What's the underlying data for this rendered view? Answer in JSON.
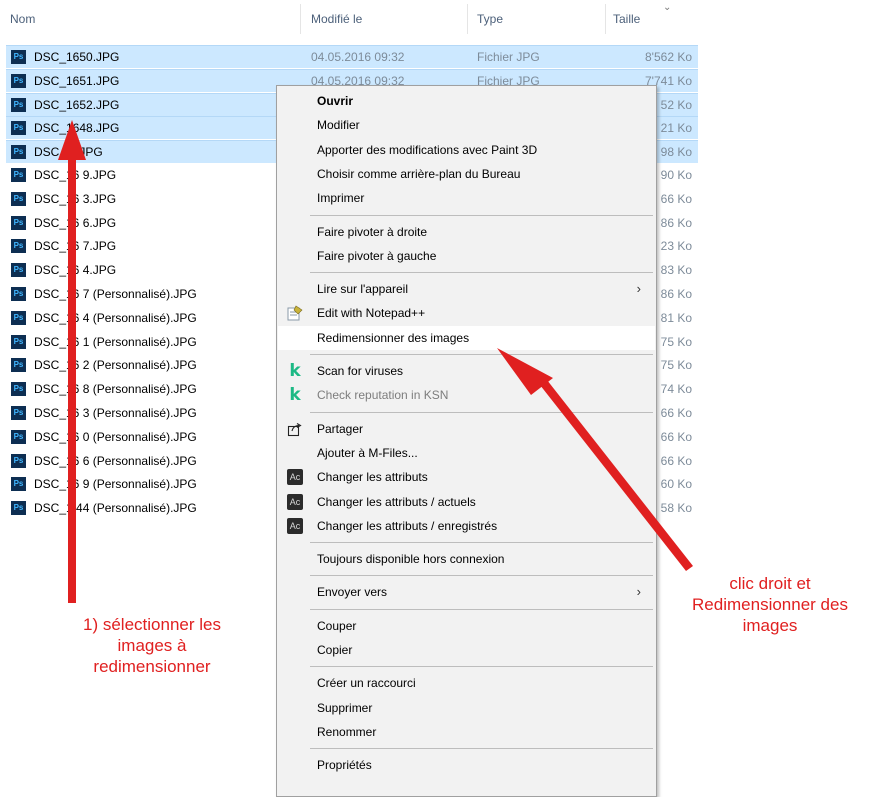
{
  "header": {
    "name": "Nom",
    "modified": "Modifié le",
    "type": "Type",
    "size": "Taille"
  },
  "files": [
    {
      "name": "DSC_1650.JPG",
      "date": "04.05.2016 09:32",
      "type": "Fichier JPG",
      "size": "8'562 Ko",
      "selected": true
    },
    {
      "name": "DSC_1651.JPG",
      "date": "04.05.2016 09:32",
      "type": "Fichier JPG",
      "size": "7'741 Ko",
      "selected": true
    },
    {
      "name": "DSC_1652.JPG",
      "date": "",
      "type": "",
      "size": "52 Ko",
      "selected": true
    },
    {
      "name": "DSC_1648.JPG",
      "date": "",
      "type": "",
      "size": "21 Ko",
      "selected": true
    },
    {
      "name": "DSC_1 .JPG",
      "date": "",
      "type": "",
      "size": "98 Ko",
      "selected": true
    },
    {
      "name": "DSC_16 9.JPG",
      "date": "",
      "type": "",
      "size": "90 Ko",
      "selected": false
    },
    {
      "name": "DSC_16 3.JPG",
      "date": "",
      "type": "",
      "size": "66 Ko",
      "selected": false
    },
    {
      "name": "DSC_16 6.JPG",
      "date": "",
      "type": "",
      "size": "86 Ko",
      "selected": false
    },
    {
      "name": "DSC_16 7.JPG",
      "date": "",
      "type": "",
      "size": "23 Ko",
      "selected": false
    },
    {
      "name": "DSC_16 4.JPG",
      "date": "",
      "type": "",
      "size": "83 Ko",
      "selected": false
    },
    {
      "name": "DSC_16 7 (Personnalisé).JPG",
      "date": "",
      "type": "",
      "size": "86 Ko",
      "selected": false
    },
    {
      "name": "DSC_16 4 (Personnalisé).JPG",
      "date": "",
      "type": "",
      "size": "81 Ko",
      "selected": false
    },
    {
      "name": "DSC_16 1 (Personnalisé).JPG",
      "date": "",
      "type": "",
      "size": "75 Ko",
      "selected": false
    },
    {
      "name": "DSC_16 2 (Personnalisé).JPG",
      "date": "",
      "type": "",
      "size": "75 Ko",
      "selected": false
    },
    {
      "name": "DSC_16 8 (Personnalisé).JPG",
      "date": "",
      "type": "",
      "size": "74 Ko",
      "selected": false
    },
    {
      "name": "DSC_16 3 (Personnalisé).JPG",
      "date": "",
      "type": "",
      "size": "66 Ko",
      "selected": false
    },
    {
      "name": "DSC_16 0 (Personnalisé).JPG",
      "date": "",
      "type": "",
      "size": "66 Ko",
      "selected": false
    },
    {
      "name": "DSC_16 6 (Personnalisé).JPG",
      "date": "",
      "type": "",
      "size": "66 Ko",
      "selected": false
    },
    {
      "name": "DSC_16 9 (Personnalisé).JPG",
      "date": "",
      "type": "",
      "size": "60 Ko",
      "selected": false
    },
    {
      "name": "DSC_1 44 (Personnalisé).JPG",
      "date": "",
      "type": "",
      "size": "58 Ko",
      "selected": false
    }
  ],
  "file_icon_text": "Ps",
  "context_menu": [
    {
      "label": "Ouvrir",
      "bold": true,
      "icon": ""
    },
    {
      "label": "Modifier",
      "icon": ""
    },
    {
      "label": "Apporter des modifications avec Paint 3D",
      "icon": ""
    },
    {
      "label": "Choisir comme arrière-plan du Bureau",
      "icon": ""
    },
    {
      "label": "Imprimer",
      "icon": ""
    },
    {
      "separator": true
    },
    {
      "label": "Faire pivoter à droite",
      "icon": ""
    },
    {
      "label": "Faire pivoter à gauche",
      "icon": ""
    },
    {
      "separator": true
    },
    {
      "label": "Lire sur l'appareil",
      "icon": "",
      "submenu": true
    },
    {
      "label": "Edit with Notepad++",
      "icon": "notepad-plus-plus-icon"
    },
    {
      "label": "Redimensionner des images",
      "icon": "",
      "highlighted": true
    },
    {
      "separator": true
    },
    {
      "label": "Scan for viruses",
      "icon": "kaspersky-icon"
    },
    {
      "label": "Check reputation in KSN",
      "icon": "kaspersky-icon",
      "dimmed": true
    },
    {
      "separator": true
    },
    {
      "label": "Partager",
      "icon": "share-icon"
    },
    {
      "label": "Ajouter à M-Files...",
      "icon": ""
    },
    {
      "label": "Changer les attributs",
      "icon": "attribute-changer-icon"
    },
    {
      "label": "Changer les attributs / actuels",
      "icon": "attribute-changer-icon"
    },
    {
      "label": "Changer les attributs / enregistrés",
      "icon": "attribute-changer-icon"
    },
    {
      "separator": true
    },
    {
      "label": "Toujours disponible hors connexion",
      "icon": ""
    },
    {
      "separator": true
    },
    {
      "label": "Envoyer vers",
      "icon": "",
      "submenu": true
    },
    {
      "separator": true
    },
    {
      "label": "Couper",
      "icon": ""
    },
    {
      "label": "Copier",
      "icon": ""
    },
    {
      "separator": true
    },
    {
      "label": "Créer un raccourci",
      "icon": ""
    },
    {
      "label": "Supprimer",
      "icon": ""
    },
    {
      "label": "Renommer",
      "icon": ""
    },
    {
      "separator": true
    },
    {
      "label": "Propriétés",
      "icon": ""
    }
  ],
  "icon_glyphs": {
    "kaspersky": "k",
    "attribute_changer": "Ac",
    "submenu_arrow": "›",
    "sort_chevron": "⌄"
  },
  "annotations": {
    "left": [
      "1) sélectionner les",
      "images à",
      "redimensionner"
    ],
    "right": [
      "clic droit et",
      "Redimensionner des",
      "images"
    ],
    "color": "#e02020"
  },
  "colors": {
    "selection": "#cce8ff",
    "menu_bg": "#f2f2f2",
    "header_text": "#4c607a",
    "meta_text": "#7d8b99"
  }
}
